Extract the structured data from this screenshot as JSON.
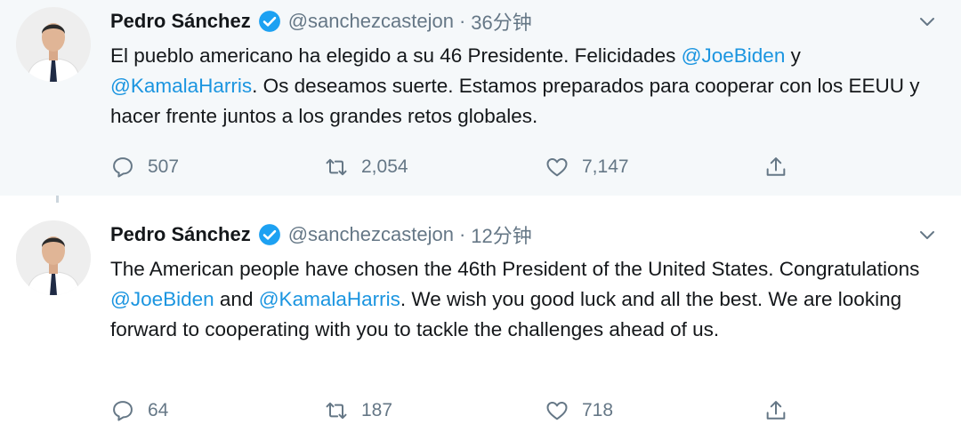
{
  "tweets": [
    {
      "name": "Pedro Sánchez",
      "handle": "@sanchezcastejon",
      "separator": "·",
      "time": "36分钟",
      "text_segments": [
        {
          "t": "El pueblo americano ha elegido a su 46 Presidente. Felicidades ",
          "mention": false
        },
        {
          "t": "@JoeBiden",
          "mention": true
        },
        {
          "t": " y ",
          "mention": false
        },
        {
          "t": "@KamalaHarris",
          "mention": true
        },
        {
          "t": ". Os deseamos suerte. Estamos preparados para cooperar con los EEUU y hacer frente juntos a los grandes retos globales.",
          "mention": false
        }
      ],
      "replies": "507",
      "retweets": "2,054",
      "likes": "7,147"
    },
    {
      "name": "Pedro Sánchez",
      "handle": "@sanchezcastejon",
      "separator": "·",
      "time": "12分钟",
      "text_segments": [
        {
          "t": "The American people have chosen the 46th President of the United States. Congratulations ",
          "mention": false
        },
        {
          "t": "@JoeBiden",
          "mention": true
        },
        {
          "t": " and ",
          "mention": false
        },
        {
          "t": "@KamalaHarris",
          "mention": true
        },
        {
          "t": ". We wish you good luck and all the best. We are looking forward to cooperating with you to tackle the challenges ahead of us.",
          "mention": false
        }
      ],
      "replies": "64",
      "retweets": "187",
      "likes": "718"
    }
  ],
  "icons": {
    "verified": "verified-badge-icon",
    "caret": "chevron-down-icon",
    "reply": "reply-icon",
    "retweet": "retweet-icon",
    "like": "heart-icon",
    "share": "share-icon"
  },
  "colors": {
    "mention": "#1b95e0",
    "verified": "#1da1f2",
    "muted": "#657786",
    "highlighted_background": "#f5f8fa"
  }
}
